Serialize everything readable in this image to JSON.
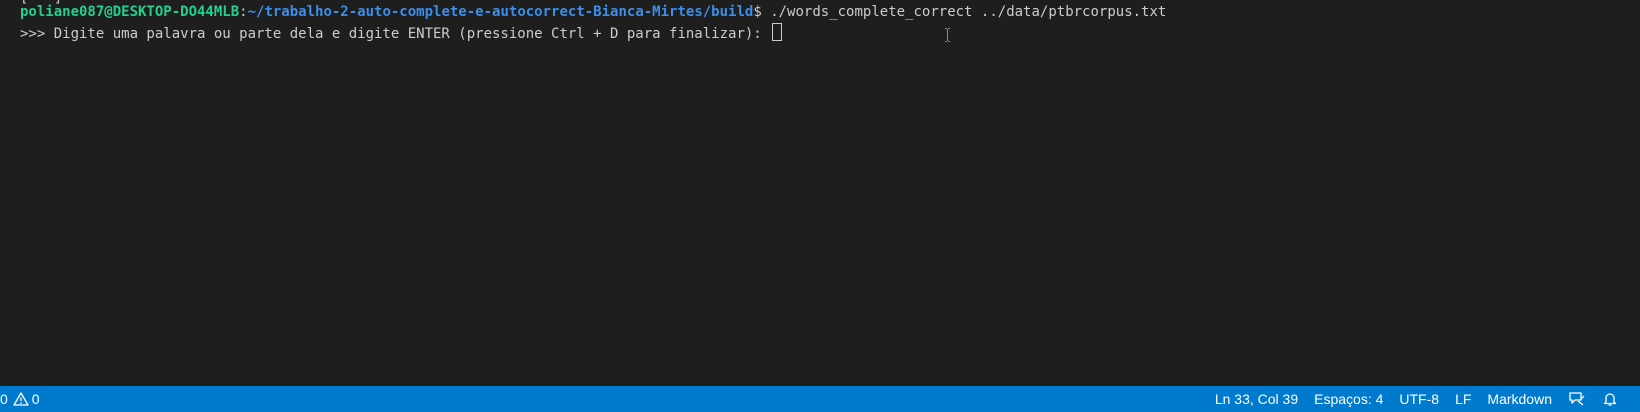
{
  "terminal": {
    "partial_top_line": "[~~~] ~~~~~~~~~ ~~~~~~~~",
    "prompt_user": "poliane087@DESKTOP-DO44MLB",
    "prompt_sep": ":",
    "prompt_path": "~/trabalho-2-auto-complete-e-autocorrect-Bianca-Mirtes/build",
    "prompt_symbol": "$",
    "command": " ./words_complete_correct ../data/ptbrcorpus.txt",
    "program_prompt": ">>> Digite uma palavra ou parte dela e digite ENTER (pressione Ctrl + D para finalizar): "
  },
  "statusbar": {
    "errors_count": "0",
    "warnings_count": "0",
    "cursor_position": "Ln 33, Col 39",
    "indentation": "Espaços: 4",
    "encoding": "UTF-8",
    "line_ending": "LF",
    "language": "Markdown",
    "feedback_icon": "feedback-icon",
    "bell_icon": "bell-icon"
  },
  "colors": {
    "terminal_bg": "#1e1e1e",
    "statusbar_bg": "#007acc",
    "prompt_user": "#23d18b",
    "prompt_path": "#3b8eea"
  }
}
